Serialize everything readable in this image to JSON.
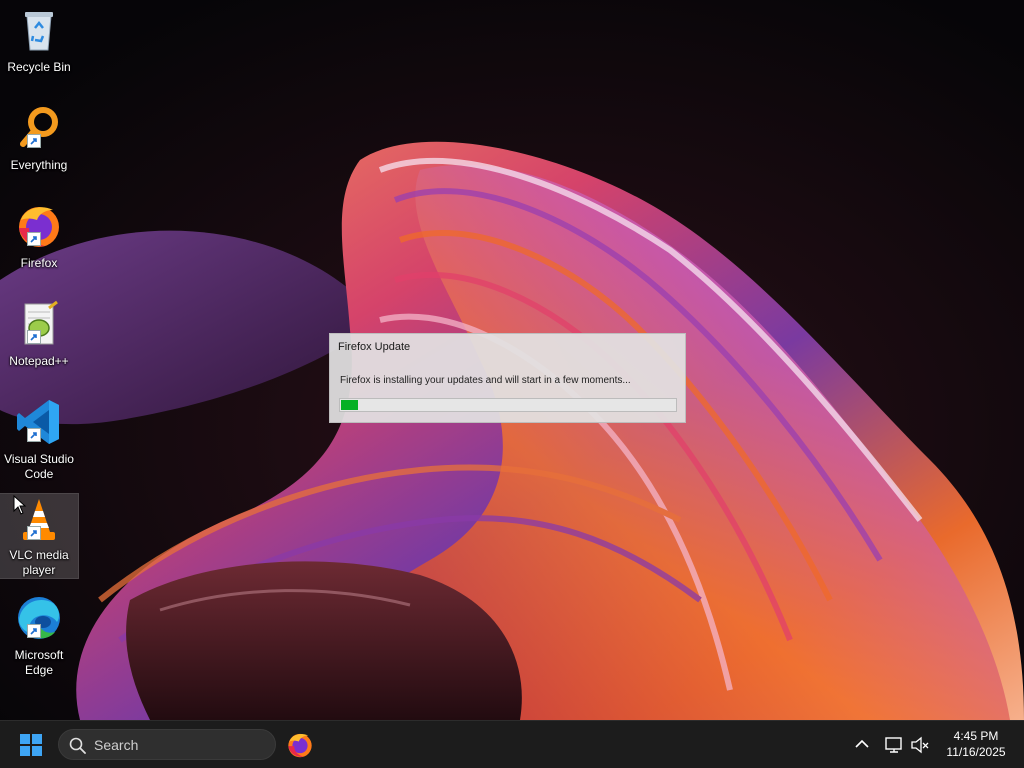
{
  "desktop": {
    "icons": [
      {
        "label": "Recycle Bin",
        "icon": "recycle-bin-icon"
      },
      {
        "label": "Everything",
        "icon": "everything-search-icon"
      },
      {
        "label": "Firefox",
        "icon": "firefox-icon"
      },
      {
        "label": "Notepad++",
        "icon": "notepad-plus-plus-icon"
      },
      {
        "label": "Visual Studio Code",
        "icon": "vscode-icon"
      },
      {
        "label": "VLC media player",
        "icon": "vlc-icon"
      },
      {
        "label": "Microsoft Edge",
        "icon": "edge-icon"
      }
    ]
  },
  "dialog": {
    "title": "Firefox Update",
    "message": "Firefox is installing your updates and will start in a few moments...",
    "progress_fraction": 0.05
  },
  "taskbar": {
    "search_placeholder": "Search",
    "pinned": [
      {
        "name": "Firefox",
        "icon": "firefox-icon"
      }
    ],
    "tray_icons": [
      "chevron-up-icon",
      "network-icon",
      "volume-muted-icon"
    ],
    "clock": {
      "time": "4:45 PM",
      "date": "11/16/2025"
    }
  },
  "colors": {
    "accent_blue": "#3ea5f4",
    "progress_green": "#06b025",
    "taskbar_bg": "#1c1c1c"
  }
}
